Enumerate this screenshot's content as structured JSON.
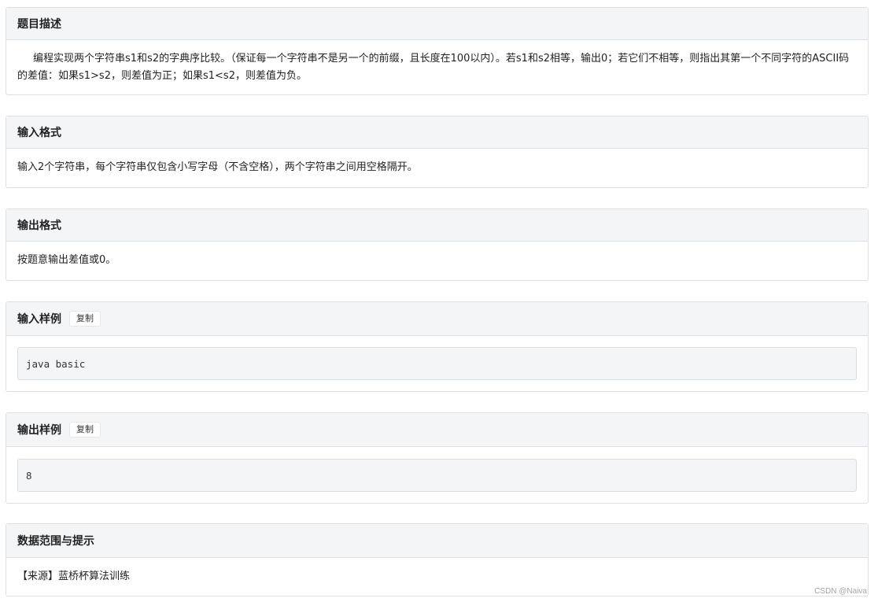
{
  "sections": {
    "description": {
      "title": "题目描述",
      "text": "编程实现两个字符串s1和s2的字典序比较。（保证每一个字符串不是另一个的前缀，且长度在100以内）。若s1和s2相等，输出0；若它们不相等，则指出其第一个不同字符的ASCII码的差值：如果s1>s2，则差值为正；如果s1<s2，则差值为负。"
    },
    "input_format": {
      "title": "输入格式",
      "text": "输入2个字符串，每个字符串仅包含小写字母（不含空格），两个字符串之间用空格隔开。"
    },
    "output_format": {
      "title": "输出格式",
      "text": "按题意输出差值或0。"
    },
    "sample_input": {
      "title": "输入样例",
      "copy_label": "复制",
      "code": "java basic"
    },
    "sample_output": {
      "title": "输出样例",
      "copy_label": "复制",
      "code": "8"
    },
    "hints": {
      "title": "数据范围与提示",
      "text": "【来源】蓝桥杯算法训练"
    }
  },
  "watermark": "CSDN @Naiva"
}
